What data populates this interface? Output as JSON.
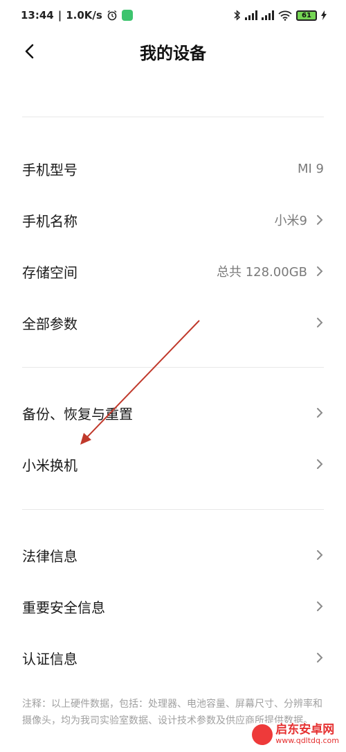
{
  "status_bar": {
    "time": "13:44",
    "speed": "1.0K/s",
    "battery": "61"
  },
  "header": {
    "title": "我的设备"
  },
  "sections": [
    {
      "items": [
        {
          "label": "手机型号",
          "value": "MI 9",
          "chevron": false
        },
        {
          "label": "手机名称",
          "value": "小米9",
          "chevron": true
        },
        {
          "label": "存储空间",
          "value": "总共 128.00GB",
          "chevron": true
        },
        {
          "label": "全部参数",
          "value": "",
          "chevron": true
        }
      ]
    },
    {
      "items": [
        {
          "label": "备份、恢复与重置",
          "value": "",
          "chevron": true
        },
        {
          "label": "小米换机",
          "value": "",
          "chevron": true
        }
      ]
    },
    {
      "items": [
        {
          "label": "法律信息",
          "value": "",
          "chevron": true
        },
        {
          "label": "重要安全信息",
          "value": "",
          "chevron": true
        },
        {
          "label": "认证信息",
          "value": "",
          "chevron": true
        }
      ]
    }
  ],
  "footnote": "注释：以上硬件数据，包括：处理器、电池容量、屏幕尺寸、分辨率和摄像头，均为我司实验室数据、设计技术参数及供应商所提供数据。",
  "watermark": {
    "title": "启东安卓网",
    "url": "www.qdltdq.com"
  },
  "colors": {
    "annotation_arrow": "#c0392b",
    "battery_fill": "#75d654"
  }
}
